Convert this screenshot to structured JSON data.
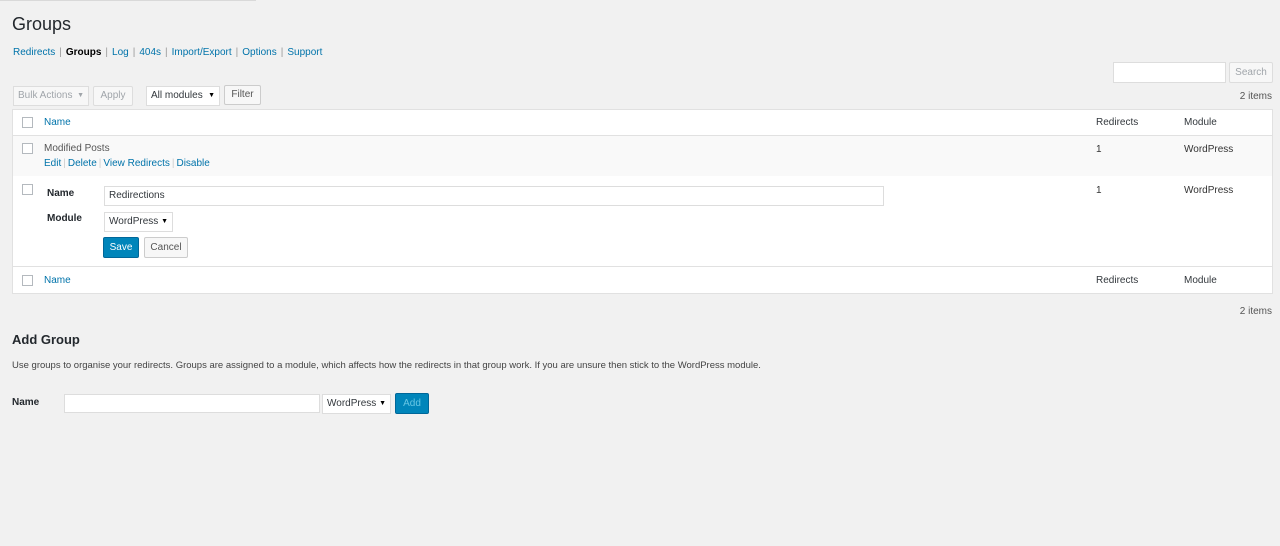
{
  "page": {
    "title": "Groups"
  },
  "subnav": [
    {
      "label": "Redirects",
      "current": false
    },
    {
      "label": "Groups",
      "current": true
    },
    {
      "label": "Log",
      "current": false
    },
    {
      "label": "404s",
      "current": false
    },
    {
      "label": "Import/Export",
      "current": false
    },
    {
      "label": "Options",
      "current": false
    },
    {
      "label": "Support",
      "current": false
    }
  ],
  "search": {
    "value": "",
    "button_label": "Search"
  },
  "toolbar": {
    "bulk_actions": "Bulk Actions",
    "apply": "Apply",
    "modules_filter": "All modules",
    "filter": "Filter",
    "items_count": "2 items"
  },
  "table": {
    "columns": {
      "name": "Name",
      "redirects": "Redirects",
      "module": "Module"
    },
    "rows": [
      {
        "name": "Modified Posts",
        "redirects": "1",
        "module": "WordPress",
        "actions": [
          "Edit",
          "Delete",
          "View Redirects",
          "Disable"
        ]
      },
      {
        "redirects": "1",
        "module": "WordPress",
        "edit_form": {
          "name_label": "Name",
          "name_value": "Redirections",
          "module_label": "Module",
          "module_value": "WordPress",
          "save": "Save",
          "cancel": "Cancel"
        }
      }
    ]
  },
  "add_group": {
    "title": "Add Group",
    "description": "Use groups to organise your redirects. Groups are assigned to a module, which affects how the redirects in that group work. If you are unsure then stick to the WordPress module.",
    "name_label": "Name",
    "name_value": "",
    "module_value": "WordPress",
    "add_button": "Add"
  },
  "colors": {
    "link": "#0073aa",
    "primary": "#0085ba",
    "background": "#f1f1f1"
  },
  "icons": {
    "dropdown": "caret-down-icon",
    "checkbox": "checkbox-icon"
  }
}
